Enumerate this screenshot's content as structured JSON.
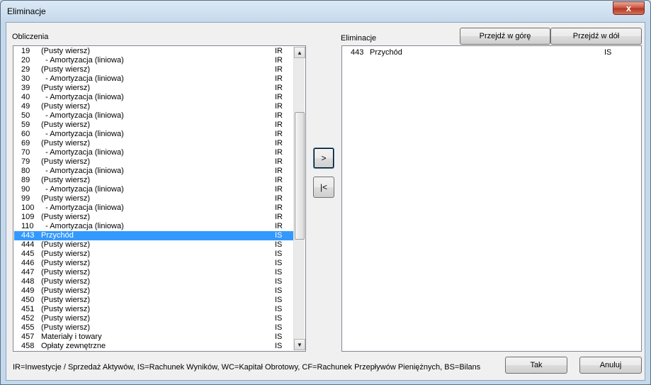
{
  "window": {
    "title": "Eliminacje",
    "close_label": "x"
  },
  "labels": {
    "obliczenia": "Obliczenia",
    "eliminacje": "Eliminacje",
    "legend": "IR=Inwestycje / Sprzedaż Aktywów, IS=Rachunek Wyników, WC=Kapitał Obrotowy, CF=Rachunek Przepływów Pieniężnych, BS=Bilans"
  },
  "buttons": {
    "move_up": "Przejdź w górę",
    "move_down": "Przejdź w dół",
    "add": ">",
    "remove": "|<",
    "ok": "Tak",
    "cancel": "Anuluj"
  },
  "left_list": [
    {
      "num": "19",
      "name": "(Pusty wiersz)",
      "type": "IR"
    },
    {
      "num": "20",
      "name": "  - Amortyzacja (liniowa)",
      "type": "IR"
    },
    {
      "num": "29",
      "name": "(Pusty wiersz)",
      "type": "IR"
    },
    {
      "num": "30",
      "name": "  - Amortyzacja (liniowa)",
      "type": "IR"
    },
    {
      "num": "39",
      "name": "(Pusty wiersz)",
      "type": "IR"
    },
    {
      "num": "40",
      "name": "  - Amortyzacja (liniowa)",
      "type": "IR"
    },
    {
      "num": "49",
      "name": "(Pusty wiersz)",
      "type": "IR"
    },
    {
      "num": "50",
      "name": "  - Amortyzacja (liniowa)",
      "type": "IR"
    },
    {
      "num": "59",
      "name": "(Pusty wiersz)",
      "type": "IR"
    },
    {
      "num": "60",
      "name": "  - Amortyzacja (liniowa)",
      "type": "IR"
    },
    {
      "num": "69",
      "name": "(Pusty wiersz)",
      "type": "IR"
    },
    {
      "num": "70",
      "name": "  - Amortyzacja (liniowa)",
      "type": "IR"
    },
    {
      "num": "79",
      "name": "(Pusty wiersz)",
      "type": "IR"
    },
    {
      "num": "80",
      "name": "  - Amortyzacja (liniowa)",
      "type": "IR"
    },
    {
      "num": "89",
      "name": "(Pusty wiersz)",
      "type": "IR"
    },
    {
      "num": "90",
      "name": "  - Amortyzacja (liniowa)",
      "type": "IR"
    },
    {
      "num": "99",
      "name": "(Pusty wiersz)",
      "type": "IR"
    },
    {
      "num": "100",
      "name": "  - Amortyzacja (liniowa)",
      "type": "IR"
    },
    {
      "num": "109",
      "name": "(Pusty wiersz)",
      "type": "IR"
    },
    {
      "num": "110",
      "name": "  - Amortyzacja (liniowa)",
      "type": "IR"
    },
    {
      "num": "443",
      "name": "Przychód",
      "type": "IS",
      "selected": true
    },
    {
      "num": "444",
      "name": "(Pusty wiersz)",
      "type": "IS"
    },
    {
      "num": "445",
      "name": "(Pusty wiersz)",
      "type": "IS"
    },
    {
      "num": "446",
      "name": "(Pusty wiersz)",
      "type": "IS"
    },
    {
      "num": "447",
      "name": "(Pusty wiersz)",
      "type": "IS"
    },
    {
      "num": "448",
      "name": "(Pusty wiersz)",
      "type": "IS"
    },
    {
      "num": "449",
      "name": "(Pusty wiersz)",
      "type": "IS"
    },
    {
      "num": "450",
      "name": "(Pusty wiersz)",
      "type": "IS"
    },
    {
      "num": "451",
      "name": "(Pusty wiersz)",
      "type": "IS"
    },
    {
      "num": "452",
      "name": "(Pusty wiersz)",
      "type": "IS"
    },
    {
      "num": "455",
      "name": "(Pusty wiersz)",
      "type": "IS"
    },
    {
      "num": "457",
      "name": "Materiały i towary",
      "type": "IS"
    },
    {
      "num": "458",
      "name": "Opłaty zewnętrzne",
      "type": "IS"
    }
  ],
  "left_scroll": {
    "position": 0.35
  },
  "right_list": [
    {
      "num": "443",
      "name": "Przychód",
      "type": "IS"
    }
  ],
  "colors": {
    "selection": "#3399ff",
    "close_button": "#c7503c"
  }
}
